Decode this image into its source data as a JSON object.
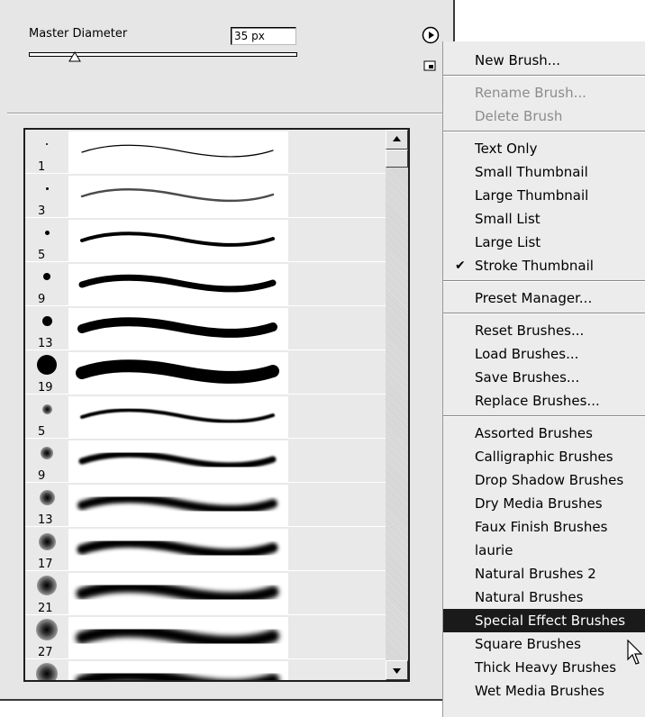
{
  "master_diameter": {
    "label": "Master Diameter",
    "value": "35 px",
    "slider_fraction": 0.17
  },
  "panel": {
    "menu_button_icon": "play-circle-icon",
    "new_preset_icon": "new-brush-icon"
  },
  "brushes": [
    {
      "size": "1",
      "type": "hard"
    },
    {
      "size": "3",
      "type": "hard"
    },
    {
      "size": "5",
      "type": "hard"
    },
    {
      "size": "9",
      "type": "hard"
    },
    {
      "size": "13",
      "type": "hard"
    },
    {
      "size": "19",
      "type": "hard"
    },
    {
      "size": "5",
      "type": "soft"
    },
    {
      "size": "9",
      "type": "soft"
    },
    {
      "size": "13",
      "type": "soft"
    },
    {
      "size": "17",
      "type": "soft"
    },
    {
      "size": "21",
      "type": "soft"
    },
    {
      "size": "27",
      "type": "soft"
    },
    {
      "size": "",
      "type": "soft"
    }
  ],
  "menu": {
    "groups": [
      [
        {
          "label": "New Brush...",
          "disabled": false
        }
      ],
      [
        {
          "label": "Rename Brush...",
          "disabled": true
        },
        {
          "label": "Delete Brush",
          "disabled": true
        }
      ],
      [
        {
          "label": "Text Only"
        },
        {
          "label": "Small Thumbnail"
        },
        {
          "label": "Large Thumbnail"
        },
        {
          "label": "Small List"
        },
        {
          "label": "Large List"
        },
        {
          "label": "Stroke Thumbnail",
          "checked": true
        }
      ],
      [
        {
          "label": "Preset Manager..."
        }
      ],
      [
        {
          "label": "Reset Brushes..."
        },
        {
          "label": "Load Brushes..."
        },
        {
          "label": "Save Brushes..."
        },
        {
          "label": "Replace Brushes..."
        }
      ],
      [
        {
          "label": "Assorted Brushes"
        },
        {
          "label": "Calligraphic Brushes"
        },
        {
          "label": "Drop Shadow Brushes"
        },
        {
          "label": "Dry Media Brushes"
        },
        {
          "label": "Faux Finish Brushes"
        },
        {
          "label": "laurie"
        },
        {
          "label": "Natural Brushes 2"
        },
        {
          "label": "Natural Brushes"
        },
        {
          "label": "Special Effect Brushes",
          "selected": true
        },
        {
          "label": "Square Brushes"
        },
        {
          "label": "Thick Heavy Brushes"
        },
        {
          "label": "Wet Media Brushes"
        }
      ]
    ]
  },
  "colors": {
    "panel_bg": "#e6e6e6",
    "menu_highlight": "#1a1a1a"
  }
}
